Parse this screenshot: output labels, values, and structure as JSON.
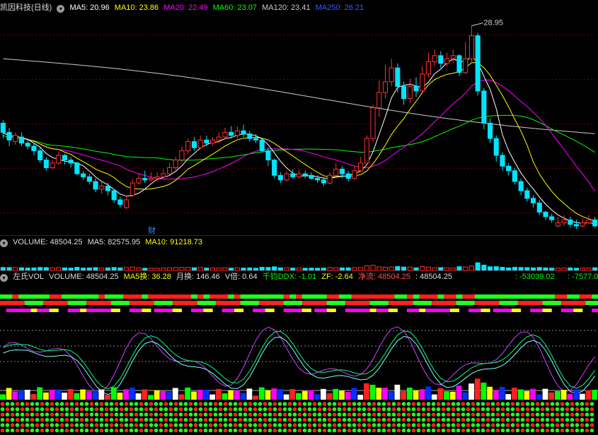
{
  "main_header": {
    "title": "凯因科技(日线)",
    "ma5": "MA5: 20.96",
    "ma10": "MA10: 23.86",
    "ma20": "MA20: 22.49",
    "ma60": "MA60: 23.07",
    "ma120": "MA120: 23.41",
    "ma250": "MA250: 26.21"
  },
  "high_label": "28.95",
  "finance_marker": "财",
  "volume_header": {
    "volume": "VOLUME: 48504.25",
    "ma5": "MA5: 82575.95",
    "ma10": "MA10: 91218.73"
  },
  "indicator_header": {
    "name": "左氏VOL",
    "volume": "VOLUME: 48504.25",
    "ma5_turnover": "MA5换: 36.28",
    "month_turnover": "月换: 146.46",
    "v_ratio": "V倍: 0.64",
    "ddx": "千钧DDX: -1.01",
    "zf": "ZF: -2.64",
    "net_flow": "净流: 48504.25",
    "value": ": 48504.25",
    "right1": ": -53039.02",
    "right2": ": -7577.0"
  },
  "colors": {
    "up": "#ff3232",
    "down": "#00e5ff",
    "ma5": "#ffffff",
    "ma10": "#ffff00",
    "ma20": "#ff00ff",
    "ma60": "#00ff00",
    "ma120": "#cccccc",
    "ma250": "#3a5cff"
  },
  "chart_data": {
    "type": "candlestick",
    "candles": [
      {
        "o": 22.6,
        "c": 22.0,
        "h": 22.8,
        "l": 21.6
      },
      {
        "o": 22.0,
        "c": 21.5,
        "h": 22.3,
        "l": 21.1
      },
      {
        "o": 21.4,
        "c": 21.8,
        "h": 22.0,
        "l": 21.2
      },
      {
        "o": 21.7,
        "c": 21.3,
        "h": 22.0,
        "l": 21.1
      },
      {
        "o": 21.3,
        "c": 21.1,
        "h": 21.5,
        "l": 20.9
      },
      {
        "o": 21.1,
        "c": 20.8,
        "h": 21.3,
        "l": 20.5
      },
      {
        "o": 20.8,
        "c": 20.2,
        "h": 21.0,
        "l": 20.0
      },
      {
        "o": 20.2,
        "c": 19.7,
        "h": 20.4,
        "l": 19.5
      },
      {
        "o": 19.7,
        "c": 20.0,
        "h": 20.2,
        "l": 19.6
      },
      {
        "o": 20.0,
        "c": 20.5,
        "h": 20.7,
        "l": 19.9
      },
      {
        "o": 20.5,
        "c": 20.2,
        "h": 20.6,
        "l": 19.9
      },
      {
        "o": 20.2,
        "c": 20.0,
        "h": 20.4,
        "l": 19.7
      },
      {
        "o": 20.0,
        "c": 19.3,
        "h": 20.1,
        "l": 19.2
      },
      {
        "o": 19.3,
        "c": 19.1,
        "h": 19.5,
        "l": 18.9
      },
      {
        "o": 19.1,
        "c": 18.8,
        "h": 19.3,
        "l": 18.6
      },
      {
        "o": 18.8,
        "c": 18.3,
        "h": 19.0,
        "l": 18.1
      },
      {
        "o": 18.3,
        "c": 18.5,
        "h": 18.8,
        "l": 18.0
      },
      {
        "o": 18.5,
        "c": 18.2,
        "h": 18.7,
        "l": 17.9
      },
      {
        "o": 18.2,
        "c": 17.6,
        "h": 18.3,
        "l": 17.4
      },
      {
        "o": 17.6,
        "c": 17.3,
        "h": 17.8,
        "l": 17.1
      },
      {
        "o": 17.1,
        "c": 17.6,
        "h": 17.9,
        "l": 17.0
      },
      {
        "o": 17.9,
        "c": 18.7,
        "h": 18.9,
        "l": 17.8
      },
      {
        "o": 18.7,
        "c": 19.0,
        "h": 19.3,
        "l": 18.6
      },
      {
        "o": 19.0,
        "c": 18.9,
        "h": 19.5,
        "l": 18.7
      },
      {
        "o": 18.9,
        "c": 19.0,
        "h": 19.4,
        "l": 18.8
      },
      {
        "o": 19.0,
        "c": 19.1,
        "h": 19.4,
        "l": 18.8
      },
      {
        "o": 19.1,
        "c": 19.3,
        "h": 19.6,
        "l": 19.0
      },
      {
        "o": 19.3,
        "c": 19.7,
        "h": 20.0,
        "l": 19.2
      },
      {
        "o": 19.7,
        "c": 20.2,
        "h": 20.4,
        "l": 19.5
      },
      {
        "o": 20.2,
        "c": 20.8,
        "h": 21.1,
        "l": 20.0
      },
      {
        "o": 20.8,
        "c": 21.4,
        "h": 21.6,
        "l": 20.6
      },
      {
        "o": 21.4,
        "c": 21.0,
        "h": 21.7,
        "l": 20.8
      },
      {
        "o": 21.0,
        "c": 21.5,
        "h": 21.8,
        "l": 20.9
      },
      {
        "o": 21.5,
        "c": 21.3,
        "h": 21.8,
        "l": 21.1
      },
      {
        "o": 21.3,
        "c": 21.5,
        "h": 21.7,
        "l": 21.1
      },
      {
        "o": 21.5,
        "c": 21.7,
        "h": 22.0,
        "l": 21.3
      },
      {
        "o": 21.7,
        "c": 22.0,
        "h": 22.3,
        "l": 21.5
      },
      {
        "o": 22.0,
        "c": 21.8,
        "h": 22.4,
        "l": 21.6
      },
      {
        "o": 21.8,
        "c": 22.1,
        "h": 22.4,
        "l": 21.6
      },
      {
        "o": 22.1,
        "c": 21.9,
        "h": 22.5,
        "l": 21.7
      },
      {
        "o": 21.9,
        "c": 21.6,
        "h": 22.1,
        "l": 21.4
      },
      {
        "o": 21.6,
        "c": 21.5,
        "h": 21.9,
        "l": 21.3
      },
      {
        "o": 21.5,
        "c": 20.8,
        "h": 21.6,
        "l": 20.7
      },
      {
        "o": 20.8,
        "c": 20.2,
        "h": 21.0,
        "l": 19.8
      },
      {
        "o": 20.2,
        "c": 19.2,
        "h": 20.3,
        "l": 19.0
      },
      {
        "o": 19.2,
        "c": 18.9,
        "h": 19.4,
        "l": 18.7
      },
      {
        "o": 18.9,
        "c": 19.3,
        "h": 19.5,
        "l": 18.8
      },
      {
        "o": 19.3,
        "c": 19.1,
        "h": 19.6,
        "l": 19.0
      },
      {
        "o": 19.1,
        "c": 19.3,
        "h": 19.6,
        "l": 19.0
      },
      {
        "o": 19.3,
        "c": 19.2,
        "h": 19.5,
        "l": 19.0
      },
      {
        "o": 19.2,
        "c": 19.0,
        "h": 19.4,
        "l": 18.9
      },
      {
        "o": 19.0,
        "c": 18.9,
        "h": 19.2,
        "l": 18.7
      },
      {
        "o": 18.9,
        "c": 18.7,
        "h": 19.1,
        "l": 18.5
      },
      {
        "o": 18.7,
        "c": 19.2,
        "h": 19.4,
        "l": 18.6
      },
      {
        "o": 19.2,
        "c": 19.6,
        "h": 20.0,
        "l": 19.1
      },
      {
        "o": 19.6,
        "c": 19.3,
        "h": 19.8,
        "l": 19.0
      },
      {
        "o": 19.3,
        "c": 19.0,
        "h": 19.5,
        "l": 18.8
      },
      {
        "o": 19.0,
        "c": 19.5,
        "h": 19.8,
        "l": 18.9
      },
      {
        "o": 19.5,
        "c": 20.0,
        "h": 20.4,
        "l": 19.4
      },
      {
        "o": 20.0,
        "c": 21.6,
        "h": 21.8,
        "l": 19.9
      },
      {
        "o": 21.6,
        "c": 23.6,
        "h": 23.8,
        "l": 21.4
      },
      {
        "o": 23.6,
        "c": 24.6,
        "h": 25.4,
        "l": 23.0
      },
      {
        "o": 24.6,
        "c": 25.3,
        "h": 26.4,
        "l": 24.2
      },
      {
        "o": 25.3,
        "c": 26.2,
        "h": 26.8,
        "l": 25.0
      },
      {
        "o": 26.2,
        "c": 25.0,
        "h": 26.5,
        "l": 24.6
      },
      {
        "o": 25.0,
        "c": 24.2,
        "h": 25.3,
        "l": 23.8
      },
      {
        "o": 24.2,
        "c": 25.0,
        "h": 25.5,
        "l": 23.9
      },
      {
        "o": 25.0,
        "c": 24.7,
        "h": 25.6,
        "l": 24.3
      },
      {
        "o": 24.7,
        "c": 25.8,
        "h": 26.3,
        "l": 24.5
      },
      {
        "o": 25.8,
        "c": 26.6,
        "h": 27.2,
        "l": 25.6
      },
      {
        "o": 26.6,
        "c": 27.0,
        "h": 27.4,
        "l": 26.3
      },
      {
        "o": 27.0,
        "c": 26.5,
        "h": 27.3,
        "l": 26.2
      },
      {
        "o": 26.5,
        "c": 26.8,
        "h": 27.2,
        "l": 26.3
      },
      {
        "o": 26.8,
        "c": 27.0,
        "h": 27.4,
        "l": 26.5
      },
      {
        "o": 27.0,
        "c": 25.9,
        "h": 27.1,
        "l": 25.7
      },
      {
        "o": 25.9,
        "c": 26.8,
        "h": 27.9,
        "l": 25.8
      },
      {
        "o": 26.8,
        "c": 28.3,
        "h": 28.95,
        "l": 26.6
      },
      {
        "o": 28.3,
        "c": 24.7,
        "h": 28.5,
        "l": 24.4
      },
      {
        "o": 24.7,
        "c": 22.6,
        "h": 24.9,
        "l": 22.2
      },
      {
        "o": 22.6,
        "c": 21.6,
        "h": 22.9,
        "l": 21.3
      },
      {
        "o": 21.6,
        "c": 20.5,
        "h": 21.8,
        "l": 20.1
      },
      {
        "o": 20.5,
        "c": 19.8,
        "h": 20.7,
        "l": 19.5
      },
      {
        "o": 19.8,
        "c": 19.5,
        "h": 20.0,
        "l": 19.2
      },
      {
        "o": 19.5,
        "c": 18.8,
        "h": 19.7,
        "l": 18.6
      },
      {
        "o": 18.8,
        "c": 18.2,
        "h": 19.0,
        "l": 17.9
      },
      {
        "o": 18.2,
        "c": 17.7,
        "h": 18.4,
        "l": 17.5
      },
      {
        "o": 17.7,
        "c": 17.4,
        "h": 17.9,
        "l": 17.1
      },
      {
        "o": 17.4,
        "c": 16.8,
        "h": 17.6,
        "l": 16.6
      },
      {
        "o": 16.8,
        "c": 16.5,
        "h": 16.9,
        "l": 16.3
      },
      {
        "o": 16.5,
        "c": 16.3,
        "h": 16.7,
        "l": 16.1
      },
      {
        "o": 15.9,
        "c": 16.1,
        "h": 16.5,
        "l": 15.8
      },
      {
        "o": 16.1,
        "c": 16.3,
        "h": 16.6,
        "l": 15.9
      },
      {
        "o": 16.3,
        "c": 16.0,
        "h": 16.5,
        "l": 15.8
      },
      {
        "o": 16.0,
        "c": 15.9,
        "h": 16.3,
        "l": 15.7
      },
      {
        "o": 15.9,
        "c": 16.1,
        "h": 16.4,
        "l": 15.8
      },
      {
        "o": 16.1,
        "c": 16.3,
        "h": 16.6,
        "l": 16.0
      },
      {
        "o": 16.3,
        "c": 15.9,
        "h": 16.5,
        "l": 15.8
      }
    ],
    "ylim": [
      15.3,
      29.8
    ]
  }
}
